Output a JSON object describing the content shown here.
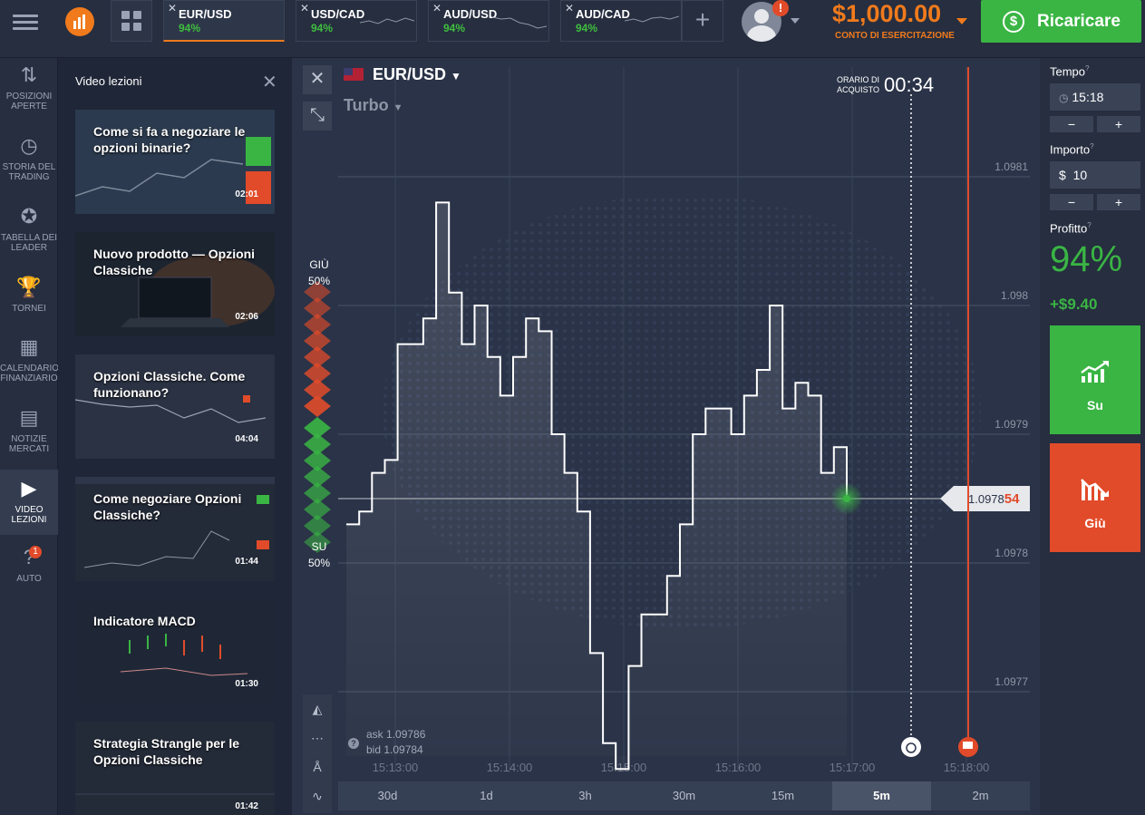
{
  "topbar": {
    "tabs": [
      {
        "close": "✕",
        "symbol": "EUR/USD",
        "payout": "94%"
      },
      {
        "close": "✕",
        "symbol": "USD/CAD",
        "payout": "94%"
      },
      {
        "close": "✕",
        "symbol": "AUD/USD",
        "payout": "94%"
      },
      {
        "close": "✕",
        "symbol": "AUD/CAD",
        "payout": "94%"
      }
    ],
    "add_tab": "+",
    "alert_count": "!",
    "balance": "$1,000.00",
    "balance_label": "CONTO DI ESERCITAZIONE",
    "recharge_label": "Ricaricare",
    "recharge_icon": "$",
    "colors": {
      "accent": "#f07a1c",
      "green": "#3ab544",
      "red": "#e14b2a"
    }
  },
  "leftnav": [
    {
      "icon": "⇅",
      "label": "POSIZIONI APERTE"
    },
    {
      "icon": "◷",
      "label": "STORIA DEL TRADING"
    },
    {
      "icon": "✪",
      "label": "TABELLA DEI LEADER"
    },
    {
      "icon": "🏆",
      "label": "TORNEI"
    },
    {
      "icon": "▦",
      "label": "CALENDARIO FINANZIARIO"
    },
    {
      "icon": "▤",
      "label": "NOTIZIE MERCATI"
    },
    {
      "icon": "▶",
      "label": "VIDEO LEZIONI"
    },
    {
      "icon": "?",
      "label": "AUTO",
      "badge": "1"
    }
  ],
  "videos": {
    "title": "Video lezioni",
    "close": "✕",
    "items": [
      {
        "title": "Come si fa a negoziare le opzioni binarie?",
        "duration": "02:01"
      },
      {
        "title": "Nuovo prodotto — Opzioni Classiche",
        "duration": "02:06"
      },
      {
        "title": "Opzioni Classiche. Come funzionano?",
        "duration": "04:04"
      },
      {
        "title": "Come negoziare Opzioni Classiche?",
        "duration": "01:44"
      },
      {
        "title": "Indicatore MACD",
        "duration": "01:30"
      },
      {
        "title": "Strategia Strangle per le Opzioni Classiche",
        "duration": "01:42"
      }
    ]
  },
  "chart": {
    "close_icon": "✕",
    "collapse_icon": "⤡",
    "pair": "EUR/USD",
    "mode": "Turbo",
    "purchase_label": "ORARIO DI ACQUISTO",
    "purchase_time": "00:34",
    "down_label": "GIÙ",
    "down_pct": "50%",
    "up_label": "SU",
    "up_pct": "50%",
    "price_main": "1.0978",
    "price_tail": "54",
    "ask": "ask 1.09786",
    "bid": "bid 1.09784",
    "help": "?",
    "periods": [
      "30d",
      "1d",
      "3h",
      "30m",
      "15m",
      "5m",
      "2m"
    ],
    "active_period": "5m"
  },
  "chart_data": {
    "type": "line",
    "title": "",
    "series": [
      {
        "values": [
          1.09783,
          1.09784,
          1.09787,
          1.09788,
          1.09797,
          1.09797,
          1.09799,
          1.09808,
          1.09801,
          1.09797,
          1.098,
          1.09796,
          1.09793,
          1.09796,
          1.09799,
          1.09798,
          1.0979,
          1.09787,
          1.09784,
          1.09773,
          1.09766,
          1.09764,
          1.09772,
          1.09776,
          1.09776,
          1.09779,
          1.09783,
          1.0979,
          1.09792,
          1.09792,
          1.0979,
          1.09793,
          1.09795,
          1.098,
          1.09792,
          1.09794,
          1.09793,
          1.09787,
          1.09789,
          1.09785
        ]
      }
    ],
    "x": [
      "15:13:00",
      "15:14:00",
      "15:15:00",
      "15:16:00",
      "15:17:00",
      "15:18:00"
    ],
    "y_ticks": [
      "1.0981",
      "1.098",
      "1.0979",
      "1.0978",
      "1.0977"
    ],
    "ylim": [
      1.09765,
      1.09815
    ],
    "current": 1.09785,
    "grid": true
  },
  "trade": {
    "time_label": "Tempo",
    "time_value": "15:18",
    "amount_label": "Importo",
    "amount_currency": "$",
    "amount_value": "10",
    "minus": "−",
    "plus": "+",
    "profit_label": "Profitto",
    "help": "?",
    "profit_pct": "94%",
    "profit_amount": "+$9.40",
    "up_label": "Su",
    "down_label": "Giù"
  }
}
